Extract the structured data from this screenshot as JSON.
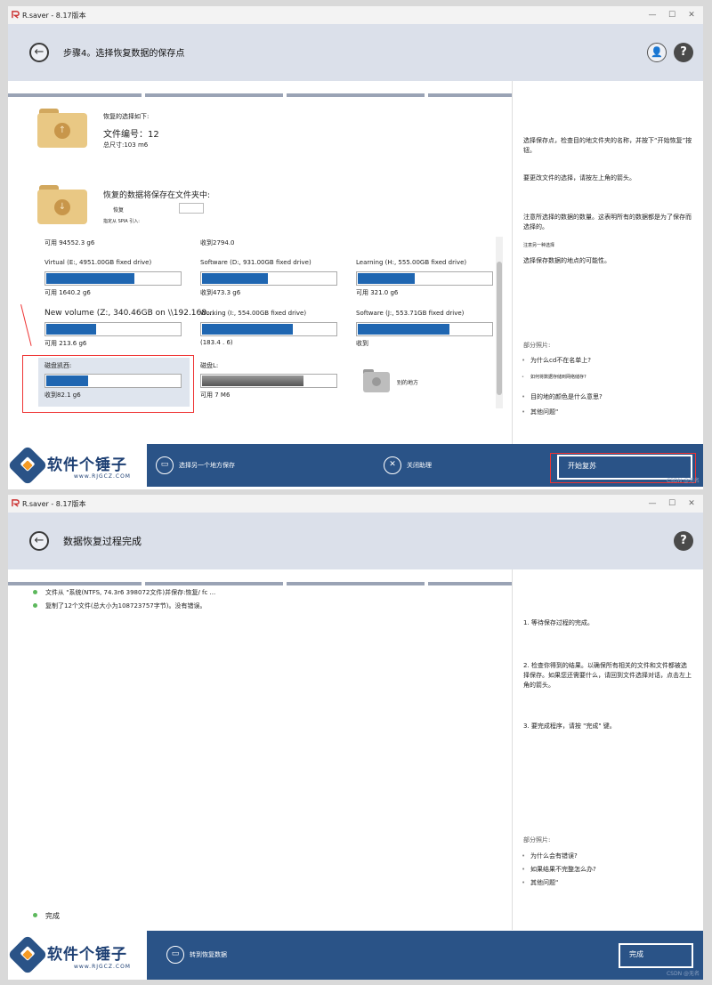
{
  "window1": {
    "app_title": "R.saver - 8.17版本",
    "header_title": "步骤4。选择恢复数据的保存点",
    "source": {
      "caption": "恢复的选择如下:",
      "file_count_label": "文件编号：",
      "file_count": "12",
      "total_size": "总尺寸:103 m6"
    },
    "destination": {
      "caption": "恢复的数据将保存在文件夹中:",
      "folder_label": "恢复",
      "folder_value": "",
      "note": "指定从 SPIA 引入:"
    },
    "drives": [
      {
        "label": "",
        "free": "可用 94552.3 g6",
        "fill": 0
      },
      {
        "label": "",
        "free": "收到2794.0",
        "fill": 0
      },
      {
        "label": "Virtual (E:, 4951.00GB fixed drive)",
        "free": "可用 1640.2 g6",
        "fill": 0.65
      },
      {
        "label": "Software (D:, 931.00GB fixed drive)",
        "free": "收到473.3 g6",
        "fill": 0.49
      },
      {
        "label": "Learning (H:, 555.00GB fixed drive)",
        "free": "可用 321.0 g6",
        "fill": 0.42
      },
      {
        "label": "New volume (Z:, 340.46GB on \\\\192.168...",
        "free": "可用 213.6 g6",
        "fill": 0.37
      },
      {
        "label": "Working (I:, 554.00GB fixed drive)",
        "free": "(183.4 . 6)",
        "fill": 0.67
      },
      {
        "label": "Software (J:, 553.71GB fixed drive)",
        "free": "收到",
        "fill": 0.68
      },
      {
        "label": "磁盘凯西:",
        "free": "收到82.1 g6",
        "fill": 0.31
      },
      {
        "label": "磁盘L:",
        "free": "可用 7 M6",
        "fill": 0.75,
        "gray": true
      }
    ],
    "other_place": "别的地方",
    "sidebar": {
      "p1": "选择保存点，检查目的地文件夹的名称，并按下“开始恢复”按钮。",
      "p2": "要更改文件的选择，请按左上角的箭头。",
      "p3": "注意所选择的数据的数量。这表明所有的数据都是为了保存而选择的。",
      "p4": "注意另一种选择",
      "p5": "选择保存数据的地点的可能性。",
      "help_title": "部分照片:",
      "help_items": [
        "为什么cd不在名单上?",
        "如何将数据存储到网络储存?",
        "目的地的颜色是什么意思?",
        "其他问题\""
      ]
    },
    "footer": {
      "choose_other": "选择另一个地方保存",
      "close_help": "关闭助理",
      "start": "开始复苏"
    }
  },
  "window2": {
    "app_title": "R.saver - 8.17版本",
    "header_title": "数据恢复过程完成",
    "log": [
      "文件从 \"系统(NTFS, 74.3r6 398072文件)并保存:恢复/ fc ...",
      "复制了12个文件(总大小为108723757字节)。没有错误。"
    ],
    "status": "完成",
    "sidebar": {
      "p1": "1. 等待保存过程的完成。",
      "p2": "2. 检查你得到的结果。以确保所有相关的文件和文件都被选择保存。如果您还需要什么，请回到文件选择对话，点击左上角的箭头。",
      "p3": "3. 要完成程序，请按 \"完成\" 键。",
      "help_title": "部分照片:",
      "help_items": [
        "为什么会有错误?",
        "如果结果不完整怎么办?",
        "其他问题\""
      ]
    },
    "footer": {
      "goto": "转到恢复数据",
      "done": "完成"
    }
  },
  "brand": {
    "name": "软件个锤子",
    "url": "www.RJGCZ.COM"
  },
  "watermark": "CSDN @无名"
}
